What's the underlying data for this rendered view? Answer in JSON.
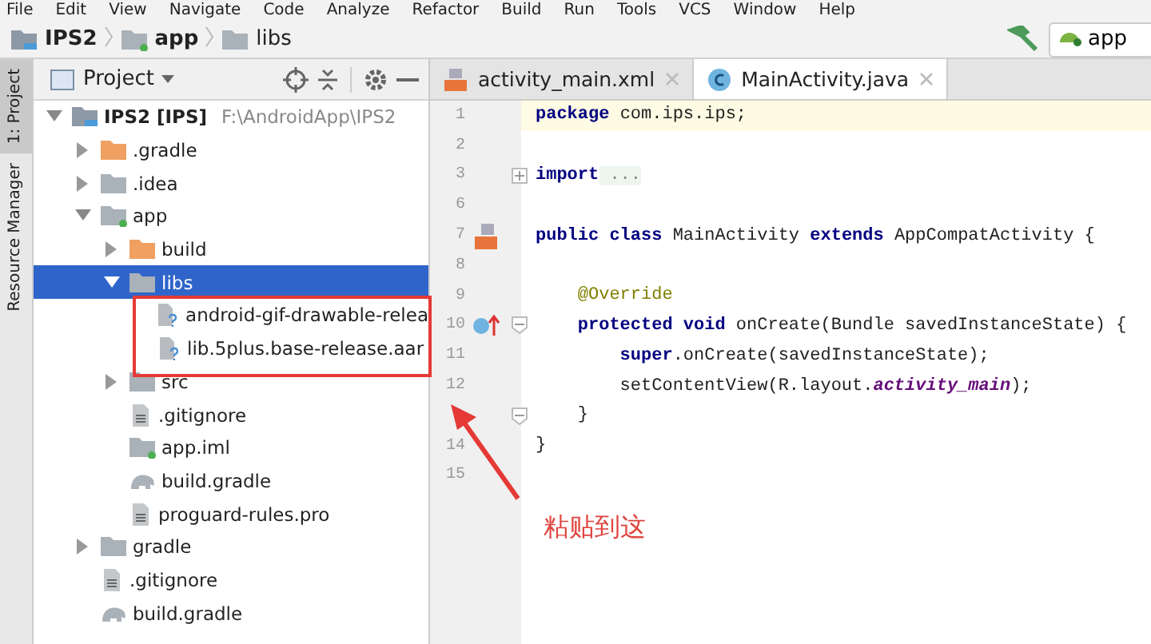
{
  "menu_bar": [
    "File",
    "Edit",
    "View",
    "Navigate",
    "Code",
    "Analyze",
    "Refactor",
    "Build",
    "Run",
    "Tools",
    "VCS",
    "Window",
    "Help"
  ],
  "breadcrumbs": [
    {
      "label": "IPS2",
      "kind": "project"
    },
    {
      "label": "app",
      "kind": "module"
    },
    {
      "label": "libs",
      "kind": "folder"
    }
  ],
  "run_config": {
    "label": "app"
  },
  "side_tabs": [
    {
      "label": "1: Project",
      "selected": true
    },
    {
      "label": "Resource Manager",
      "selected": false
    }
  ],
  "project_panel": {
    "title": "Project",
    "tree": [
      {
        "label": "IPS2 [IPS]",
        "path": "F:\\AndroidApp\\IPS2",
        "kind": "project",
        "expanded": true,
        "selected": false,
        "children": [
          {
            "label": ".gradle",
            "kind": "excluded",
            "expanded": false,
            "selected": false
          },
          {
            "label": ".idea",
            "kind": "folder",
            "expanded": false,
            "selected": false
          },
          {
            "label": "app",
            "kind": "module",
            "expanded": true,
            "selected": false,
            "children": [
              {
                "label": "build",
                "kind": "excluded",
                "expanded": false,
                "selected": false
              },
              {
                "label": "libs",
                "kind": "folder",
                "expanded": true,
                "selected": true,
                "children": [
                  {
                    "label": "android-gif-drawable-relea",
                    "kind": "unknown",
                    "selected": false
                  },
                  {
                    "label": "lib.5plus.base-release.aar",
                    "kind": "unknown",
                    "selected": false
                  }
                ]
              },
              {
                "label": "src",
                "kind": "folder",
                "expanded": false,
                "selected": false
              },
              {
                "label": ".gitignore",
                "kind": "text",
                "selected": false
              },
              {
                "label": "app.iml",
                "kind": "module",
                "selected": false
              },
              {
                "label": "build.gradle",
                "kind": "gradle",
                "selected": false
              },
              {
                "label": "proguard-rules.pro",
                "kind": "text",
                "selected": false
              }
            ]
          },
          {
            "label": "gradle",
            "kind": "folder",
            "expanded": false,
            "selected": false
          },
          {
            "label": ".gitignore",
            "kind": "text",
            "selected": false
          },
          {
            "label": "build.gradle",
            "kind": "gradle",
            "selected": false
          }
        ]
      }
    ]
  },
  "editor_tabs": [
    {
      "label": "activity_main.xml",
      "kind": "layout",
      "selected": false
    },
    {
      "label": "MainActivity.java",
      "kind": "class",
      "selected": true
    }
  ],
  "code_lines": [
    {
      "number": "1",
      "highlighted": true,
      "kind": "plain",
      "tokens": [
        {
          "kind": "keyword",
          "text": "package"
        },
        {
          "kind": "plain",
          "text": " com.ips.ips;"
        }
      ]
    },
    {
      "number": "2",
      "highlighted": false,
      "kind": "plain"
    },
    {
      "number": "3",
      "highlighted": false,
      "kind": "folded",
      "tokens": [
        {
          "kind": "keyword",
          "text": "import"
        },
        {
          "kind": "folded",
          "text": " ..."
        }
      ]
    },
    {
      "number": "6",
      "highlighted": false,
      "kind": "plain"
    },
    {
      "number": "7",
      "highlighted": false,
      "kind": "layout",
      "tokens": [
        {
          "kind": "keyword",
          "text": "public class"
        },
        {
          "kind": "plain",
          "text": " MainActivity "
        },
        {
          "kind": "keyword",
          "text": "extends"
        },
        {
          "kind": "plain",
          "text": " AppCompatActivity {"
        }
      ]
    },
    {
      "number": "8",
      "highlighted": false,
      "kind": "plain"
    },
    {
      "number": "9",
      "highlighted": false,
      "kind": "plain",
      "tokens": [
        {
          "kind": "annotation",
          "text": "    @Override"
        }
      ]
    },
    {
      "number": "10",
      "highlighted": false,
      "kind": "override",
      "tokens": [
        {
          "kind": "keyword",
          "text": "    protected void"
        },
        {
          "kind": "plain",
          "text": " onCreate(Bundle savedInstanceState) {"
        }
      ]
    },
    {
      "number": "11",
      "highlighted": false,
      "kind": "plain",
      "tokens": [
        {
          "kind": "keyword",
          "text": "        super"
        },
        {
          "kind": "plain",
          "text": ".onCreate(savedInstanceState);"
        }
      ]
    },
    {
      "number": "12",
      "highlighted": false,
      "kind": "plain",
      "tokens": [
        {
          "kind": "plain",
          "text": "        setContentView(R.layout."
        },
        {
          "kind": "field",
          "text": "activity_main"
        },
        {
          "kind": "plain",
          "text": ");"
        }
      ]
    },
    {
      "highlighted": false,
      "kind": "blockend",
      "tokens": [
        {
          "kind": "plain",
          "text": "    }"
        }
      ]
    },
    {
      "number": "14",
      "highlighted": false,
      "kind": "plain",
      "tokens": [
        {
          "kind": "plain",
          "text": "}"
        }
      ]
    },
    {
      "number": "15",
      "highlighted": false,
      "kind": "plain"
    }
  ],
  "annotation": {
    "text": "粘贴到这"
  }
}
